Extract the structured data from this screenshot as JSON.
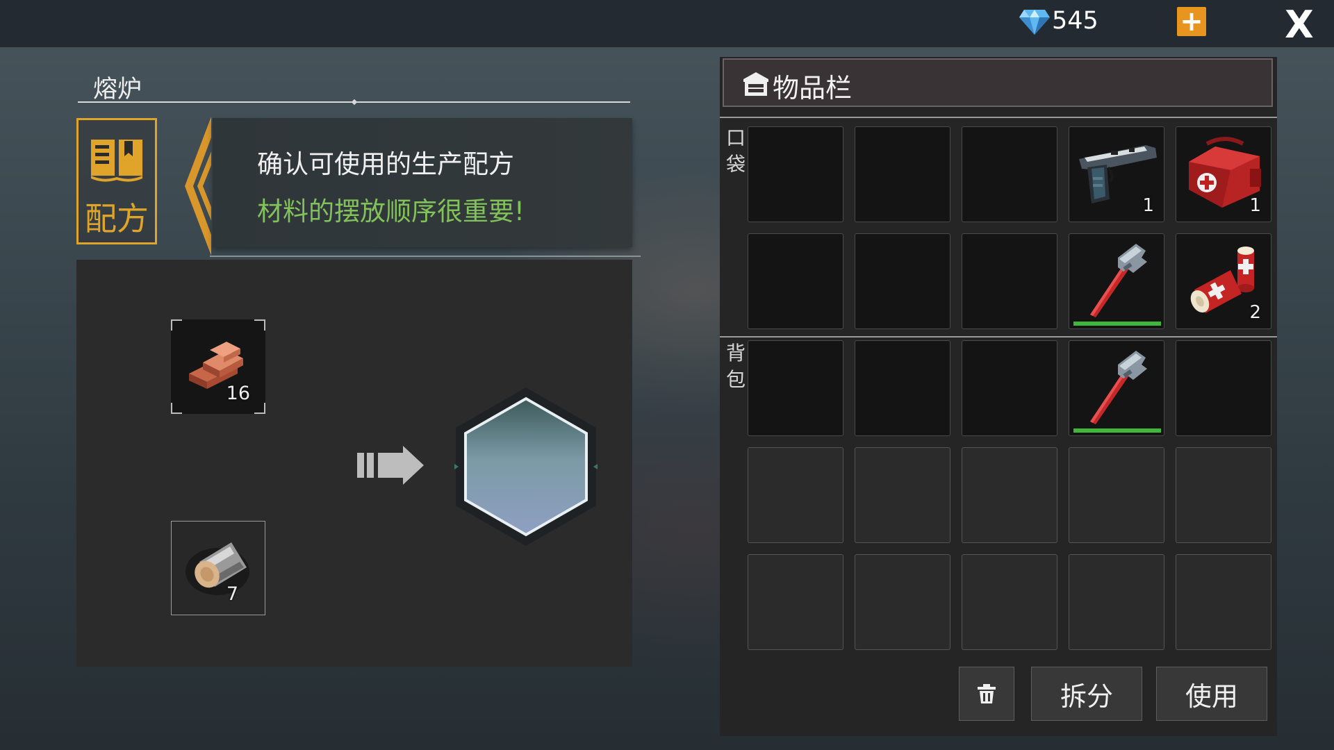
{
  "currency": {
    "icon": "diamond-icon",
    "amount": "545"
  },
  "topbar": {
    "add_label": "+",
    "close_label": "X"
  },
  "station": {
    "title": "熔炉"
  },
  "recipe_button": {
    "label": "配方",
    "icon": "recipe-book-icon"
  },
  "hint": {
    "line1": "确认可使用的生产配方",
    "line2": "材料的摆放顺序很重要!"
  },
  "crafting": {
    "inputs": [
      {
        "item": "copper-ingots",
        "count": "16"
      },
      {
        "item": "log",
        "count": "7"
      }
    ],
    "result": {
      "state": "empty"
    }
  },
  "inventory": {
    "title": "物品栏",
    "icon": "storage-icon",
    "pocket_label": "口\n袋",
    "backpack_label": "背\n包",
    "pocket_rows": [
      [
        {
          "item": ""
        },
        {
          "item": ""
        },
        {
          "item": ""
        },
        {
          "item": "pistol",
          "count": "1"
        },
        {
          "item": "medkit-bag",
          "count": "1"
        }
      ],
      [
        {
          "item": ""
        },
        {
          "item": ""
        },
        {
          "item": ""
        },
        {
          "item": "pipe-wrench",
          "durability": 1.0
        },
        {
          "item": "bandage",
          "count": "2"
        }
      ]
    ],
    "backpack_rows": [
      [
        {
          "item": ""
        },
        {
          "item": ""
        },
        {
          "item": ""
        },
        {
          "item": "pipe-wrench",
          "durability": 1.0
        },
        {
          "item": ""
        }
      ],
      [
        {
          "item": ""
        },
        {
          "item": ""
        },
        {
          "item": ""
        },
        {
          "item": ""
        },
        {
          "item": ""
        }
      ],
      [
        {
          "item": ""
        },
        {
          "item": ""
        },
        {
          "item": ""
        },
        {
          "item": ""
        },
        {
          "item": ""
        }
      ]
    ],
    "actions": {
      "delete_icon": "trash-icon",
      "split_label": "拆分",
      "use_label": "使用"
    }
  },
  "colors": {
    "accent": "#e0a42a",
    "hint_green": "#82c25a",
    "plus": "#e89520",
    "durability": "#3fb83a"
  }
}
